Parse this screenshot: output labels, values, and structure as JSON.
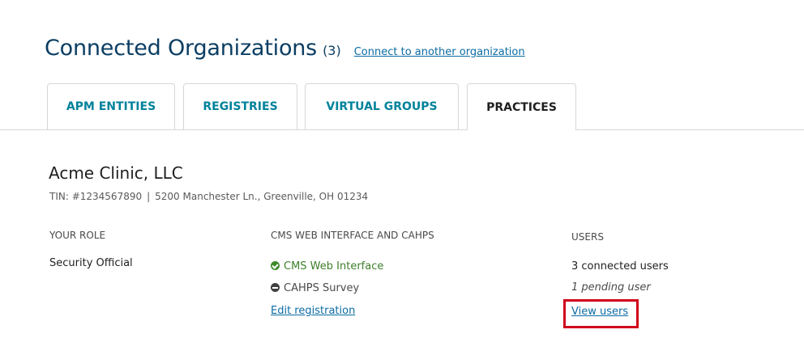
{
  "header": {
    "title": "Connected Organizations",
    "count": "(3)",
    "connect_link": "Connect to another organization"
  },
  "tabs": [
    {
      "label": "APM ENTITIES",
      "active": false
    },
    {
      "label": "REGISTRIES",
      "active": false
    },
    {
      "label": "VIRTUAL GROUPS",
      "active": false
    },
    {
      "label": "PRACTICES",
      "active": true
    }
  ],
  "organization": {
    "name": "Acme Clinic, LLC",
    "tin": "TIN: #1234567890",
    "separator": "|",
    "address": "5200 Manchester Ln., Greenville, OH 01234",
    "columns": {
      "role_header": "YOUR ROLE",
      "cms_header": "CMS WEB INTERFACE AND CAHPS",
      "users_header": "USERS"
    },
    "role": "Security Official",
    "cms_items": [
      {
        "label": "CMS Web Interface",
        "status": "enabled",
        "icon": "check-circle-icon"
      },
      {
        "label": "CAHPS Survey",
        "status": "disabled",
        "icon": "minus-circle-icon"
      }
    ],
    "edit_link": "Edit registration",
    "users": {
      "connected": "3 connected users",
      "pending": "1 pending user",
      "view_link": "View users"
    }
  },
  "colors": {
    "title": "#0b3e63",
    "tab_text": "#00829b",
    "link": "#0b6ba3",
    "enabled": "#3d7f2a",
    "highlight": "#d0021b"
  }
}
